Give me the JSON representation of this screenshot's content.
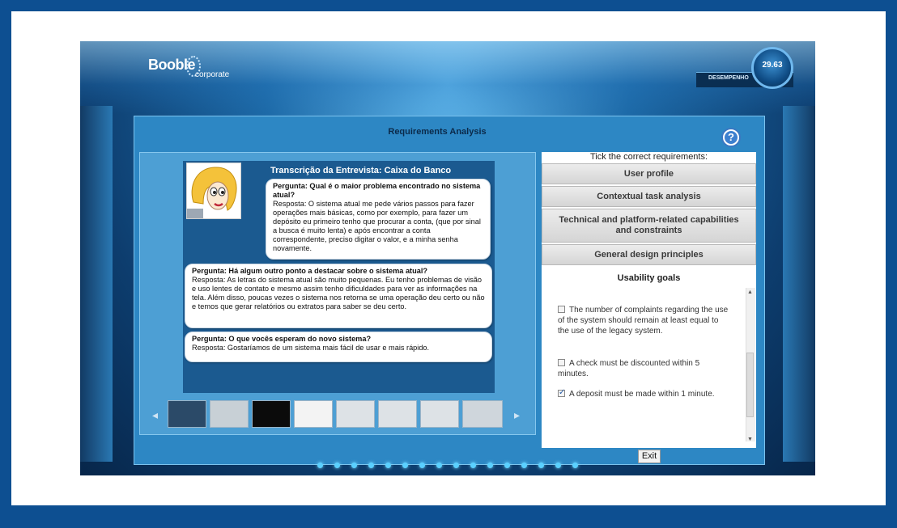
{
  "header": {
    "logo": "Booble",
    "logo_sub": "corporate",
    "performance_label": "DESEMPENHO",
    "performance_value": "29.63"
  },
  "screen": {
    "title": "Requirements Analysis",
    "help_glyph": "?"
  },
  "interview": {
    "title": "Transcrição da Entrevista: Caixa do Banco",
    "qa": [
      {
        "question": "Pergunta: Qual é o maior problema encontrado no sistema atual?",
        "answer": "Resposta: O sistema atual me pede vários passos para fazer operações mais básicas, como por exemplo, para fazer um depósito eu primeiro tenho que procurar a conta, (que por sinal a busca é muito lenta) e após encontrar a conta correspondente, preciso digitar o valor, e a minha senha novamente."
      },
      {
        "question": "Pergunta: Há algum outro ponto a destacar sobre o sistema atual?",
        "answer": "Resposta: As letras do sistema atual são muito pequenas. Eu tenho problemas de visão e uso lentes de contato e mesmo assim tenho dificuldades para ver as informações na tela. Além disso, poucas vezes o sistema nos retorna se uma operação deu certo ou não e temos que gerar relatórios ou extratos para saber se deu certo."
      },
      {
        "question": "Pergunta: O que vocês esperam do novo sistema?",
        "answer": "Resposta: Gostaríamos de um sistema mais fácil de usar e mais rápido."
      }
    ]
  },
  "requirements": {
    "instruction": "Tick the correct requirements:",
    "categories": [
      "User profile",
      "Contextual task analysis",
      "Technical and platform-related capabilities and constraints",
      "General design principles"
    ],
    "active_category": "Usability goals",
    "goals": [
      {
        "text": "The number of complaints regarding the use of the system should remain at least equal to the use of the legacy system.",
        "checked": false
      },
      {
        "text": "A check must be discounted within 5 minutes.",
        "checked": false
      },
      {
        "text": "A deposit must be made within 1 minute.",
        "checked": true
      }
    ]
  },
  "actions": {
    "exit_label": "Exit"
  },
  "colors": {
    "frame_border": "#0d4f91",
    "accent": "#2d87c4",
    "button_text": "#3a3a3a"
  }
}
